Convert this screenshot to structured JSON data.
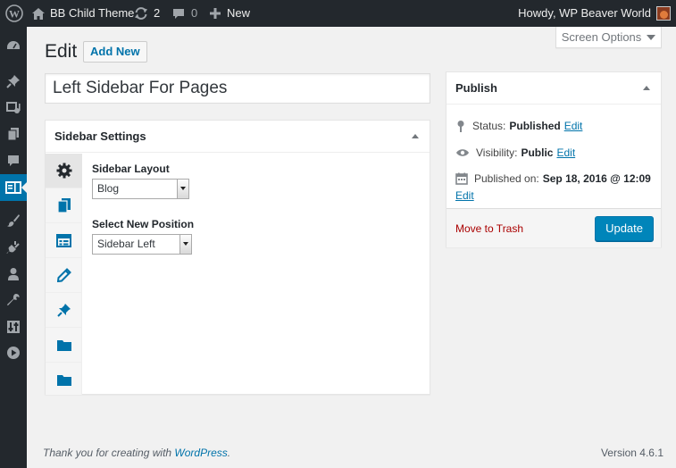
{
  "admin_bar": {
    "site_name": "BB Child Theme",
    "updates_count": "2",
    "comments_count": "0",
    "new_label": "New",
    "howdy": "Howdy, WP Beaver World"
  },
  "admin_menu": {
    "items": [
      "dashboard-icon",
      "pin-icon",
      "media-icon",
      "pages-icon",
      "comments-icon",
      "sidebar-icon",
      "appearance-icon",
      "plugins-icon",
      "users-icon",
      "tools-icon",
      "settings-icon",
      "play-icon"
    ],
    "current": "sidebar-icon"
  },
  "screen_options": "Screen Options",
  "page": {
    "title": "Edit",
    "add_new": "Add New",
    "post_title": "Left Sidebar For Pages"
  },
  "sidebar_settings": {
    "heading": "Sidebar Settings",
    "tabs": [
      "gear-icon",
      "pages-icon",
      "layout-icon",
      "pencil-icon",
      "pin-icon",
      "folder-icon",
      "folder-icon"
    ],
    "layout_label": "Sidebar Layout",
    "layout_value": "Blog",
    "position_label": "Select New Position",
    "position_value": "Sidebar Left"
  },
  "publish": {
    "heading": "Publish",
    "status_label": "Status:",
    "status_value": "Published",
    "visibility_label": "Visibility:",
    "visibility_value": "Public",
    "published_label": "Published on:",
    "published_value": "Sep 18, 2016 @ 12:09",
    "edit": "Edit",
    "trash": "Move to Trash",
    "update": "Update"
  },
  "footer": {
    "thanks": "Thank you for creating with",
    "wordpress": "WordPress",
    "period": ".",
    "version": "Version 4.6.1"
  },
  "colors": {
    "accent": "#0073aa",
    "button": "#0085ba",
    "trash": "#a00",
    "admin_bg": "#23282d"
  }
}
